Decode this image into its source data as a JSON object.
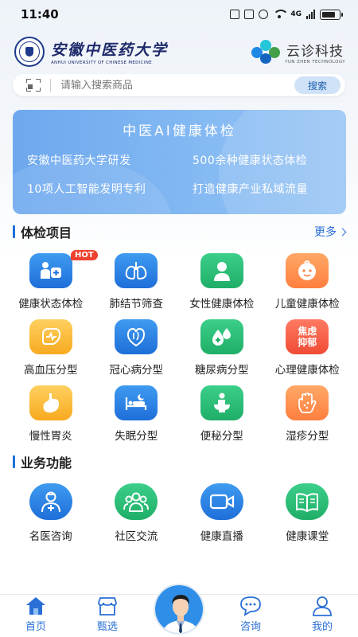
{
  "status_bar": {
    "time": "11:40",
    "network": "4G"
  },
  "header": {
    "university_name": "安徽中医药大学",
    "university_name_en": "ANHUI UNIVERSITY OF CHINESE MEDICINE",
    "brand_name": "云诊科技",
    "brand_name_en": "YUN ZHEN TECHNOLOGY"
  },
  "search": {
    "placeholder": "请输入搜索商品",
    "button_label": "搜索"
  },
  "banner": {
    "title": "中医AI健康体检",
    "lines": [
      "安徽中医药大学研发",
      "500余种健康状态体检",
      "10项人工智能发明专利",
      "打造健康产业私域流量"
    ]
  },
  "exam_section": {
    "title": "体检项目",
    "more_label": "更多",
    "items": [
      {
        "label": "健康状态体检",
        "icon": "health-check-icon",
        "color": "blue",
        "badge": "HOT"
      },
      {
        "label": "肺结节筛查",
        "icon": "lungs-icon",
        "color": "blue"
      },
      {
        "label": "女性健康体检",
        "icon": "female-icon",
        "color": "green"
      },
      {
        "label": "儿童健康体检",
        "icon": "child-face-icon",
        "color": "orange"
      },
      {
        "label": "高血压分型",
        "icon": "blood-pressure-icon",
        "color": "yellow"
      },
      {
        "label": "冠心病分型",
        "icon": "heart-icon",
        "color": "blue"
      },
      {
        "label": "糖尿病分型",
        "icon": "drops-icon",
        "color": "green"
      },
      {
        "label": "心理健康体检",
        "icon": "mental-icon",
        "color": "red",
        "icon_text": "焦虑抑郁"
      },
      {
        "label": "慢性胃炎",
        "icon": "stomach-icon",
        "color": "yellow"
      },
      {
        "label": "失眠分型",
        "icon": "bed-moon-icon",
        "color": "blue"
      },
      {
        "label": "便秘分型",
        "icon": "toilet-icon",
        "color": "green"
      },
      {
        "label": "湿疹分型",
        "icon": "hand-icon",
        "color": "orange"
      }
    ]
  },
  "business_section": {
    "title": "业务功能",
    "items": [
      {
        "label": "名医咨询",
        "icon": "doctor-icon",
        "color": "blue"
      },
      {
        "label": "社区交流",
        "icon": "community-icon",
        "color": "green"
      },
      {
        "label": "健康直播",
        "icon": "video-camera-icon",
        "color": "blue"
      },
      {
        "label": "健康课堂",
        "icon": "book-icon",
        "color": "green"
      }
    ]
  },
  "bottom_nav": {
    "items": [
      {
        "label": "首页",
        "icon": "home-icon",
        "active": true
      },
      {
        "label": "甄选",
        "icon": "shop-icon"
      },
      {
        "label": "",
        "icon": "doctor-avatar"
      },
      {
        "label": "咨询",
        "icon": "chat-icon"
      },
      {
        "label": "我的",
        "icon": "user-icon"
      }
    ]
  },
  "colors": {
    "primary": "#1e6fd9",
    "green": "#1fae67",
    "orange": "#ff7f3f",
    "hot_badge": "#f0412f"
  }
}
